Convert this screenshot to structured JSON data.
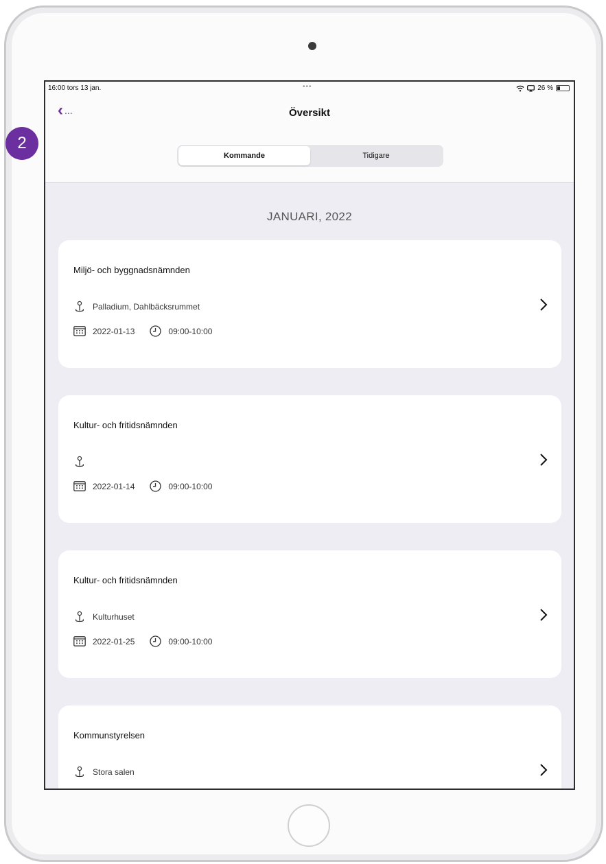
{
  "step_badge": {
    "label": "2",
    "color": "#6b2fa0"
  },
  "status_bar": {
    "time_date": "16:00  tors 13 jan.",
    "dots": "•••",
    "battery_text": "26 %",
    "battery_level_percent": 26
  },
  "nav": {
    "back_icon": "chevron-left-icon",
    "back_label": "...",
    "title": "Översikt",
    "accent_color": "#6b2fa0"
  },
  "segments": [
    {
      "label": "Kommande",
      "selected": true
    },
    {
      "label": "Tidigare",
      "selected": false
    }
  ],
  "list": {
    "month_header": "JANUARI, 2022",
    "meetings": [
      {
        "title": "Miljö- och byggnadsnämnden",
        "location": "Palladium, Dahlbäcksrummet",
        "date": "2022-01-13",
        "time": "09:00-10:00"
      },
      {
        "title": "Kultur- och fritidsnämnden",
        "location": "",
        "date": "2022-01-14",
        "time": "09:00-10:00"
      },
      {
        "title": "Kultur- och fritidsnämnden",
        "location": "Kulturhuset",
        "date": "2022-01-25",
        "time": "09:00-10:00"
      },
      {
        "title": "Kommunstyrelsen",
        "location": "Stora salen",
        "date": "",
        "time": ""
      }
    ]
  }
}
